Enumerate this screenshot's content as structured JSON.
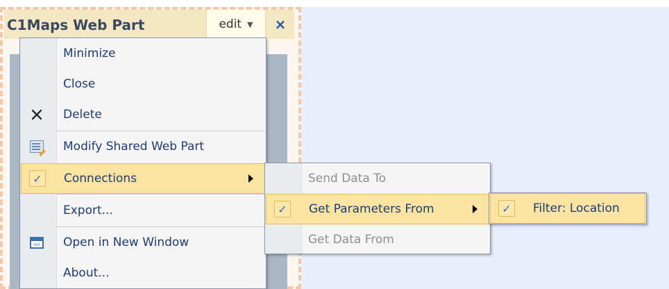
{
  "webpart": {
    "title": "C1Maps Web Part",
    "edit_label": "edit",
    "close_glyph": "×"
  },
  "main_menu": {
    "items": [
      {
        "label": "Minimize",
        "icon": null
      },
      {
        "label": "Close",
        "icon": null
      },
      {
        "label": "Delete",
        "icon": "delete-x-icon"
      },
      {
        "label": "Modify Shared Web Part",
        "icon": "edit-properties-icon"
      },
      {
        "label": "Connections",
        "icon": "check-icon",
        "has_submenu": true,
        "highlighted": true
      },
      {
        "label": "Export...",
        "icon": null
      },
      {
        "label": "Open in New Window",
        "icon": "window-icon"
      },
      {
        "label": "About...",
        "icon": null
      }
    ]
  },
  "connections_menu": {
    "items": [
      {
        "label": "Send Data To",
        "disabled": true
      },
      {
        "label": "Get Parameters From",
        "has_submenu": true,
        "highlighted": true,
        "checked": true
      },
      {
        "label": "Get Data From",
        "disabled": true
      }
    ]
  },
  "parameters_menu": {
    "items": [
      {
        "label": "Filter: Location",
        "highlighted": true,
        "checked": true
      }
    ]
  },
  "colors": {
    "highlight": "#fbe4a2",
    "menu_text": "#1f3b73",
    "disabled_text": "#8b8f94",
    "close_x": "#215aa3"
  }
}
